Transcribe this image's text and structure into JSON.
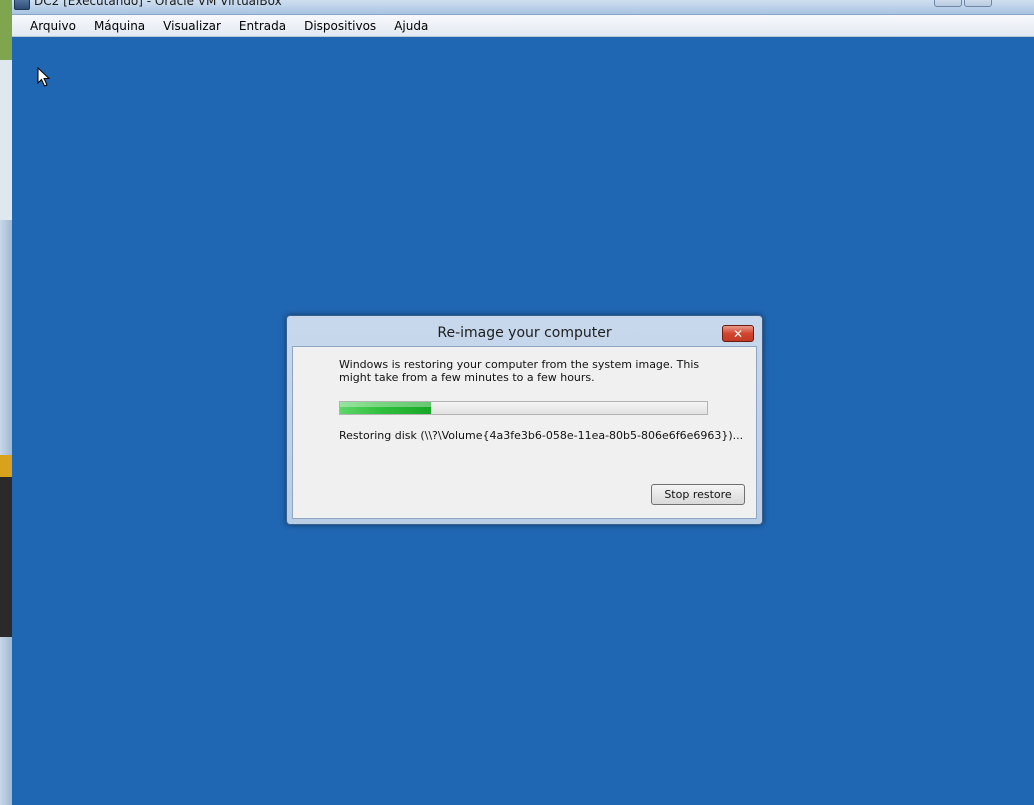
{
  "window": {
    "title": "DC2 [Executando] - Oracle VM VirtualBox"
  },
  "menu": {
    "items": [
      "Arquivo",
      "Máquina",
      "Visualizar",
      "Entrada",
      "Dispositivos",
      "Ajuda"
    ]
  },
  "dialog": {
    "title": "Re-image your computer",
    "close_symbol": "✕",
    "message": "Windows is restoring your computer from the system image. This might take from a few minutes to a few hours.",
    "progress_fraction": 0.247,
    "status": "Restoring disk (\\\\?\\Volume{4a3fe3b6-058e-11ea-80b5-806e6f6e6963})...",
    "stop_button_label": "Stop restore"
  },
  "colors": {
    "guest_background": "#1f66b3",
    "progress_green": "#2fbf3c"
  }
}
